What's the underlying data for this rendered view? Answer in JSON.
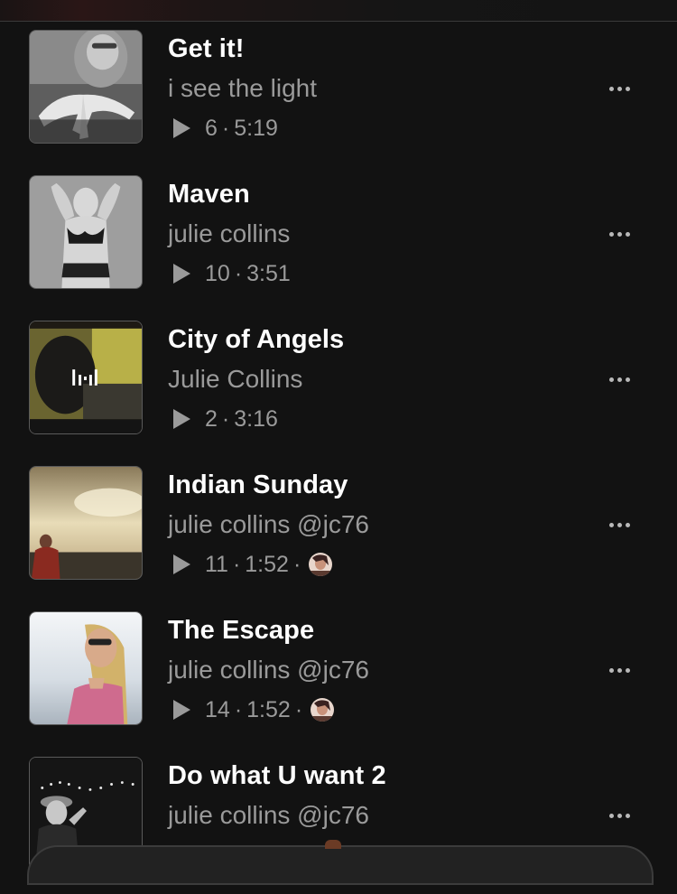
{
  "tracks": [
    {
      "title": "Get it!",
      "artist": "i see the light",
      "plays": "6",
      "duration": "5:19",
      "has_avatar": false,
      "artwork": "grayscale-hand-portrait"
    },
    {
      "title": "Maven",
      "artist": "julie collins",
      "plays": "10",
      "duration": "3:51",
      "has_avatar": false,
      "artwork": "grayscale-woman-portrait"
    },
    {
      "title": "City of Angels",
      "artist": "Julie Collins",
      "plays": "2",
      "duration": "3:16",
      "has_avatar": false,
      "artwork": "dark-room-video-with-waveform-logo"
    },
    {
      "title": "Indian Sunday",
      "artist": "julie collins @jc76",
      "plays": "11",
      "duration": "1:52",
      "has_avatar": true,
      "artwork": "sunset-sky-person"
    },
    {
      "title": "The Escape",
      "artist": "julie collins @jc76",
      "plays": "14",
      "duration": "1:52",
      "has_avatar": true,
      "artwork": "sky-woman-sunglasses"
    },
    {
      "title": "Do what U want 2",
      "artist": "julie collins @jc76",
      "plays": "",
      "duration": "",
      "has_avatar": false,
      "artwork": "night-lights-person-hat"
    }
  ],
  "separator": "·",
  "icons": {
    "play": "play-icon",
    "more": "more-options-icon",
    "collaborator": "collaborator-avatar"
  },
  "colors": {
    "background": "#121212",
    "title": "#ffffff",
    "secondary": "#9a9a9a"
  }
}
